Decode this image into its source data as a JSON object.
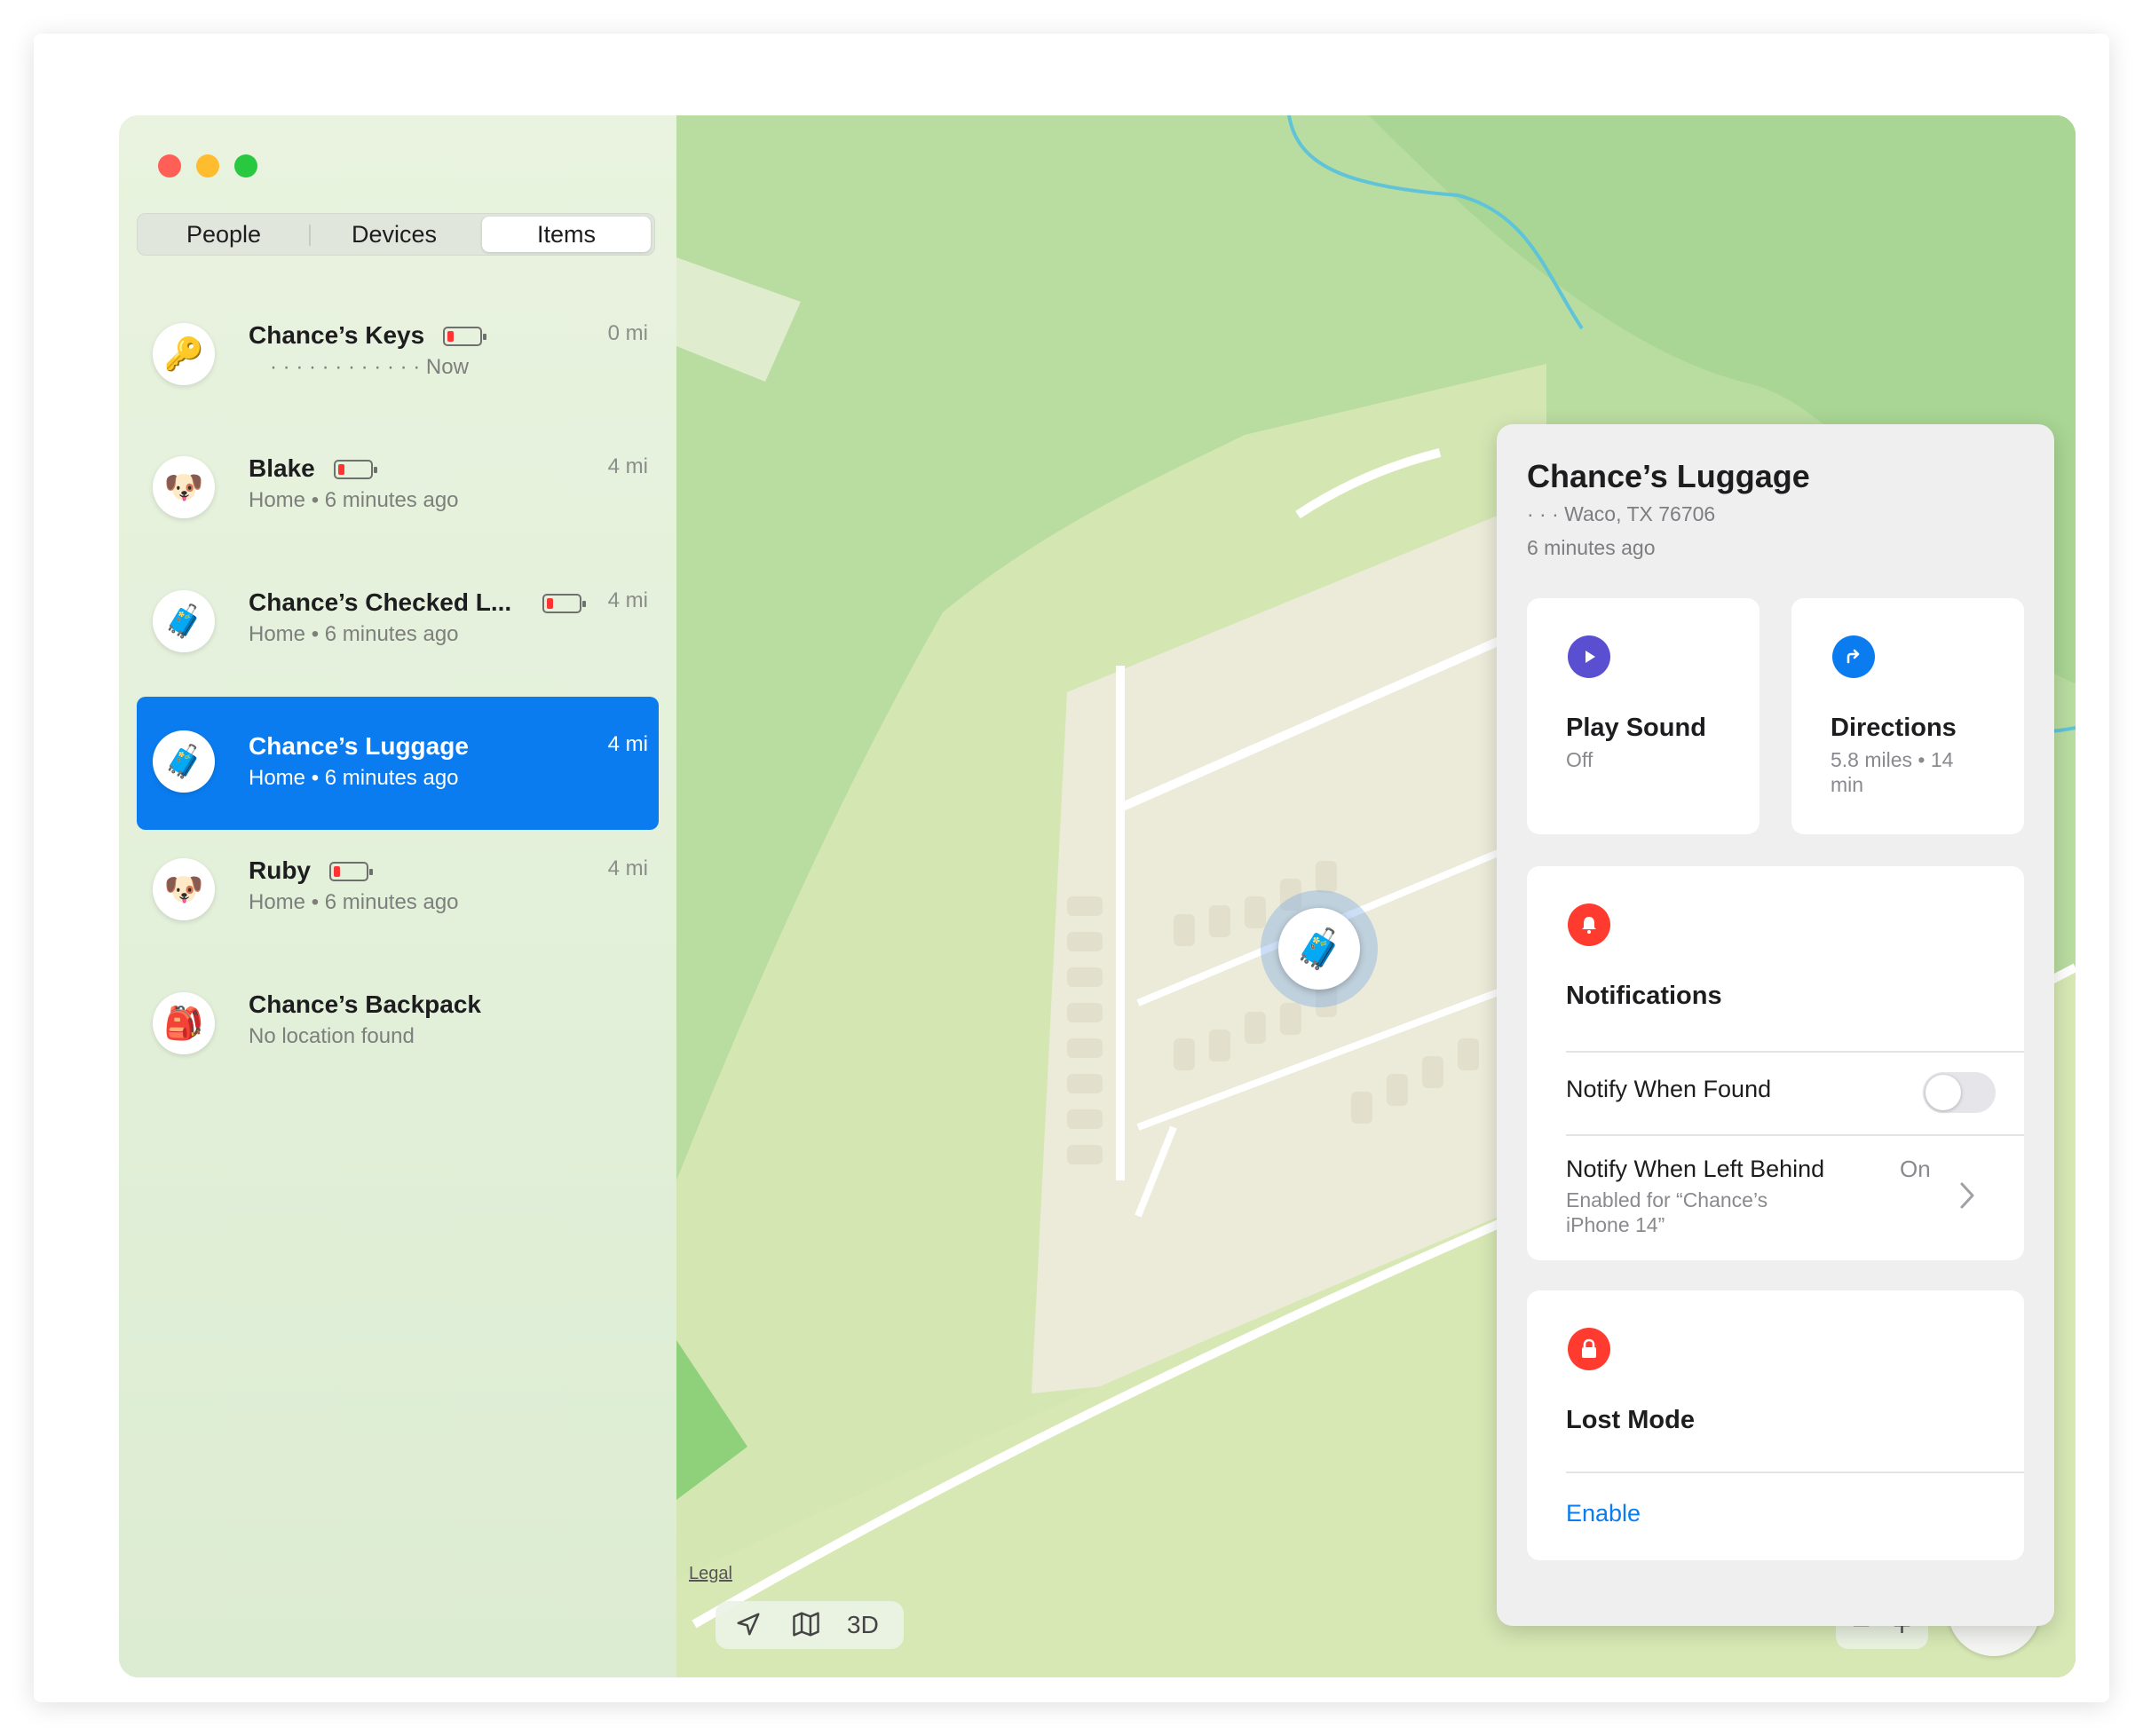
{
  "window": {
    "controls": [
      "close",
      "minimize",
      "zoom"
    ]
  },
  "tabs": {
    "people": "People",
    "devices": "Devices",
    "items": "Items",
    "selected": "Items"
  },
  "items": [
    {
      "name": "Chance’s Keys",
      "sub": "· · · · · · · · · · · · Now",
      "dist": "0 mi",
      "icon": "key-icon",
      "emoji": "🔑",
      "battery": "low"
    },
    {
      "name": "Blake",
      "sub": "Home • 6 minutes ago",
      "dist": "4 mi",
      "icon": "dog-icon",
      "emoji": "🐶",
      "battery": "low"
    },
    {
      "name": "Chance’s Checked L...",
      "sub": "Home • 6 minutes ago",
      "dist": "4 mi",
      "icon": "suitcase-icon",
      "emoji": "🧳",
      "battery": "low"
    },
    {
      "name": "Chance’s Luggage",
      "sub": "Home • 6 minutes ago",
      "dist": "4 mi",
      "icon": "suitcase-icon",
      "emoji": "🧳",
      "selected": true
    },
    {
      "name": "Ruby",
      "sub": "Home • 6 minutes ago",
      "dist": "4 mi",
      "icon": "dog-icon",
      "emoji": "🐶",
      "battery": "low"
    },
    {
      "name": "Chance’s Backpack",
      "sub": "No location found",
      "dist": "",
      "icon": "backpack-icon",
      "emoji": "🎒"
    }
  ],
  "panel": {
    "title": "Chance’s Luggage",
    "address": "· · · Waco, TX  76706",
    "updated": "6 minutes ago",
    "play_sound": {
      "title": "Play Sound",
      "sub": "Off",
      "icon": "play-icon",
      "color": "#5a4fd0"
    },
    "directions": {
      "title": "Directions",
      "sub": "5.8 miles • 14 min",
      "icon": "directions-icon",
      "color": "#0a7cf0"
    },
    "notifications": {
      "title": "Notifications",
      "icon": "bell-icon",
      "color": "#ff3b30",
      "notify_found": {
        "label": "Notify When Found",
        "enabled": false
      },
      "notify_left": {
        "label": "Notify When Left Behind",
        "value": "On",
        "sub": "Enabled for “Chance’s iPhone 14”"
      }
    },
    "lost_mode": {
      "title": "Lost Mode",
      "action": "Enable",
      "icon": "lock-icon",
      "color": "#ff3b30"
    }
  },
  "map_controls": {
    "legal": "Legal",
    "mode_3d": "3D",
    "zoom_out": "−",
    "zoom_in": "+",
    "compass": "N"
  },
  "colors": {
    "accent": "#0a7cf0",
    "sidebar": "#e5f1dc",
    "map_green": "#b7dc9e"
  }
}
